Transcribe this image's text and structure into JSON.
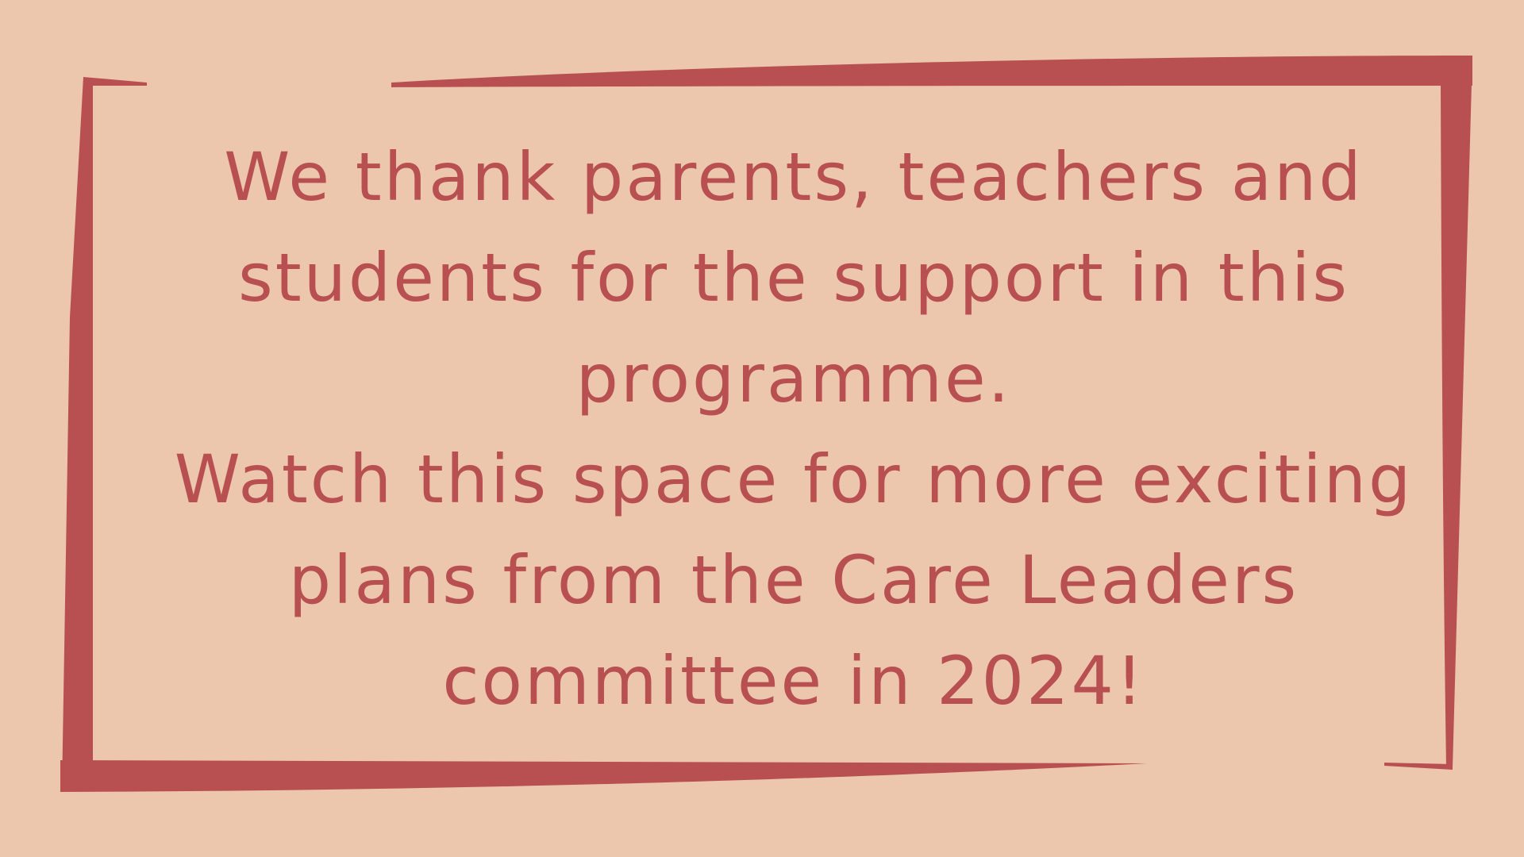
{
  "colors": {
    "background": "#ecc7ad",
    "accent": "#b85052"
  },
  "message": {
    "lines": [
      "We thank parents, teachers and",
      "students for the support in this",
      "programme.",
      "Watch this space for more exciting",
      "plans from the Care Leaders",
      "committee in 2024!"
    ]
  }
}
